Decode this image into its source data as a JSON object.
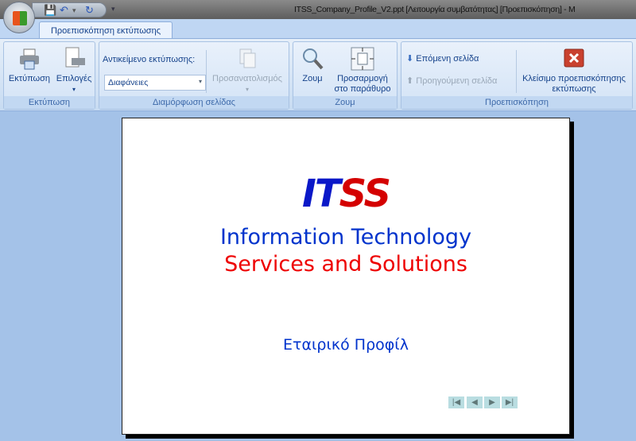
{
  "window": {
    "title": "ITSS_Company_Profile_V2.ppt [Λειτουργία συμβατότητας] [Προεπισκόπηση] - M"
  },
  "qat": {
    "save": "save-icon",
    "undo": "undo-icon",
    "redo": "redo-icon",
    "customize": "▾"
  },
  "tab": {
    "label": "Προεπισκόπηση εκτύπωσης"
  },
  "groups": {
    "print": {
      "label": "Εκτύπωση",
      "print": "Εκτύπωση",
      "options": "Επιλογές"
    },
    "page_setup": {
      "label": "Διαμόρφωση σελίδας",
      "print_what_label": "Αντικείμενο εκτύπωσης:",
      "print_what_value": "Διαφάνειες",
      "orientation": "Προσανατολισμός"
    },
    "zoom": {
      "label": "Ζουμ",
      "zoom": "Ζουμ",
      "fit_line1": "Προσαρμογή",
      "fit_line2": "στο παράθυρο"
    },
    "preview": {
      "label": "Προεπισκόπηση",
      "next": "Επόμενη σελίδα",
      "previous": "Προηγούμενη σελίδα",
      "close_line1": "Κλείσιμο προεπισκόπησης",
      "close_line2": "εκτύπωσης"
    }
  },
  "slide": {
    "logo_part1": "IT",
    "logo_part2": "SS",
    "line1": "Information Technology",
    "line2": "Services and Solutions",
    "subtitle": "Εταιρικό Προφίλ",
    "nav": [
      "|◀",
      "◀",
      "▶",
      "▶|"
    ]
  },
  "colors": {
    "blue": "#0033cc",
    "red": "#ee0000",
    "background": "#a4c2e8"
  }
}
